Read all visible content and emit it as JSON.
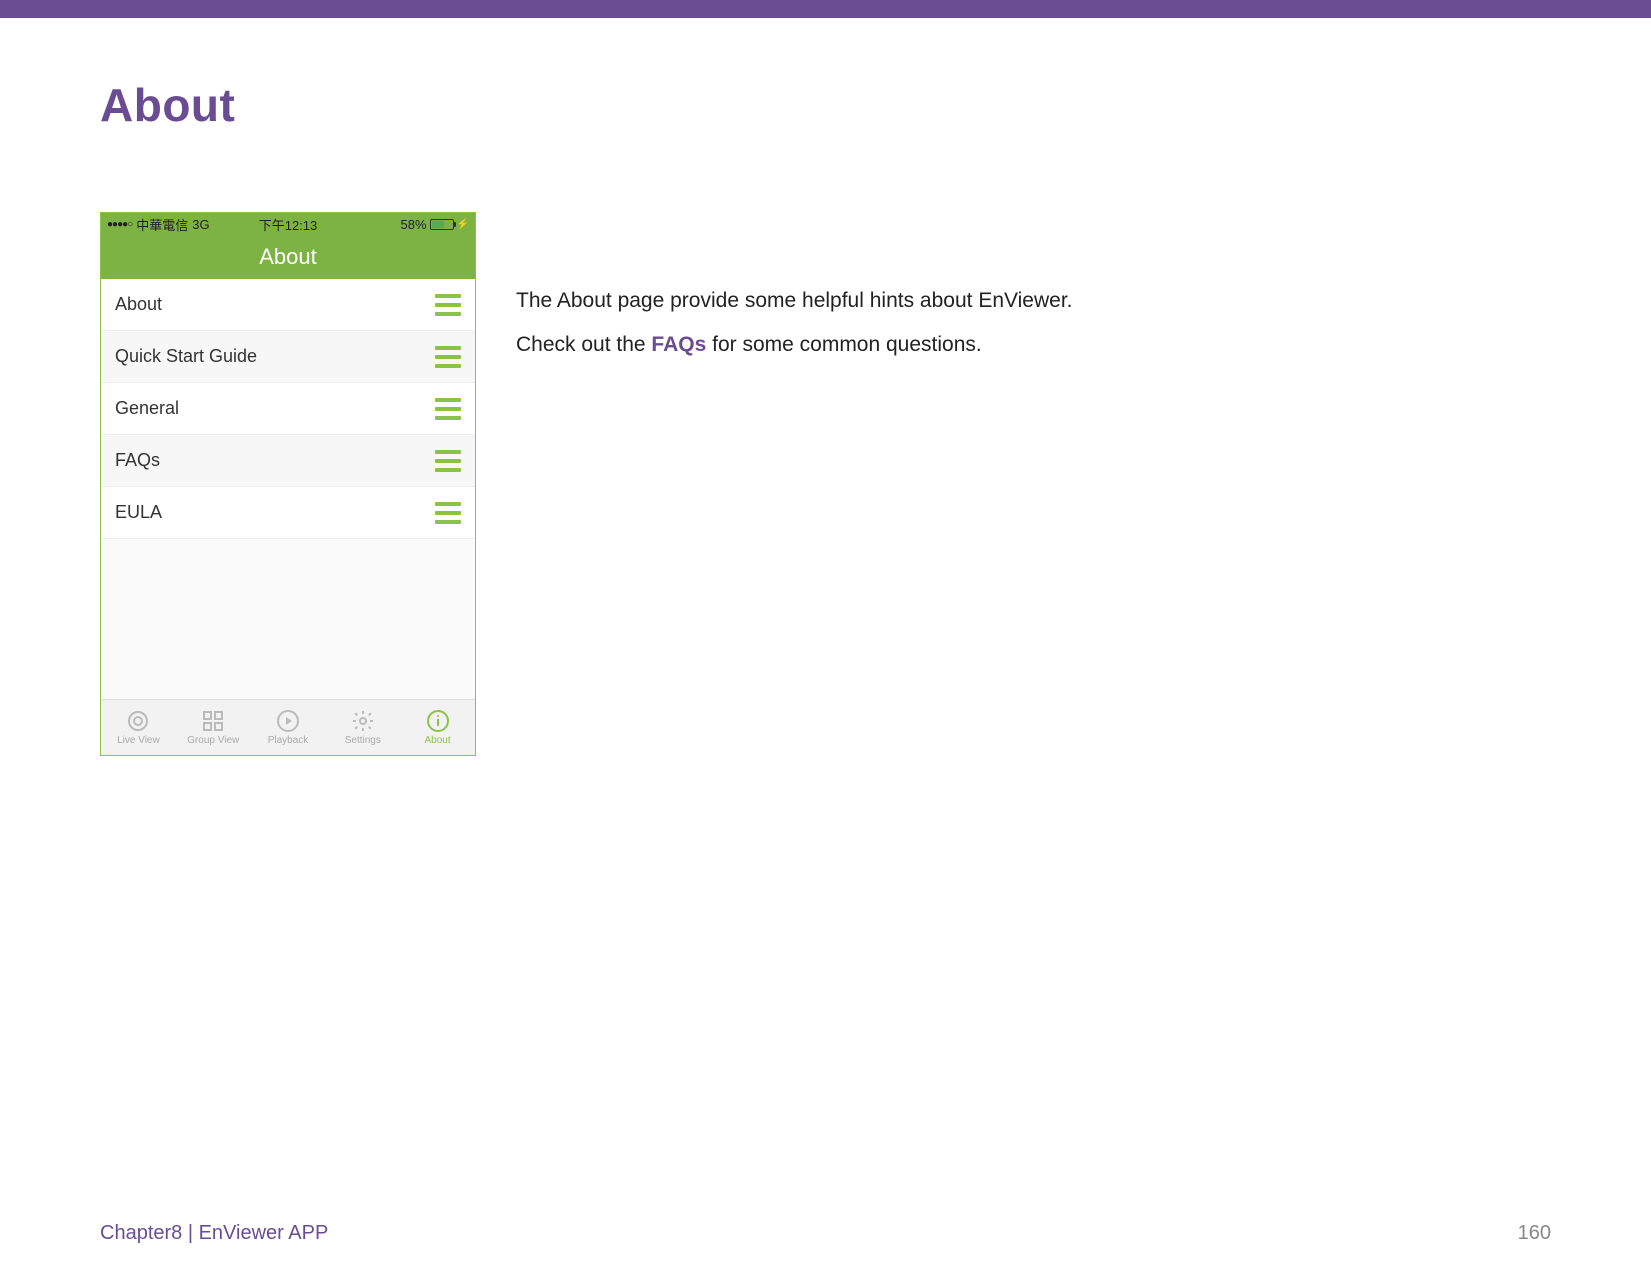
{
  "heading": "About",
  "phone": {
    "status": {
      "carrier": "中華電信",
      "network": "3G",
      "time": "下午12:13",
      "battery_pct": "58%"
    },
    "nav_title": "About",
    "list": [
      {
        "label": "About"
      },
      {
        "label": "Quick Start Guide"
      },
      {
        "label": "General"
      },
      {
        "label": "FAQs"
      },
      {
        "label": "EULA"
      }
    ],
    "tabs": [
      {
        "label": "Live View"
      },
      {
        "label": "Group View"
      },
      {
        "label": "Playback"
      },
      {
        "label": "Settings"
      },
      {
        "label": "About"
      }
    ]
  },
  "body": {
    "line1": "The About page provide some helpful hints about EnViewer.",
    "line2_pre": "Check out the ",
    "line2_link": "FAQs",
    "line2_post": " for some common questions."
  },
  "footer": {
    "left": "Chapter8  |  EnViewer APP",
    "right": "160"
  }
}
